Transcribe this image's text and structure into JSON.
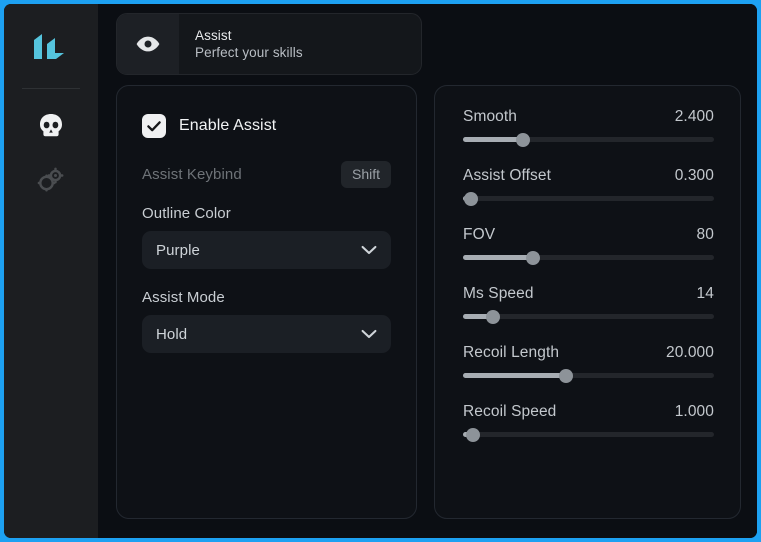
{
  "window": {
    "accent_border_color": "#1da1f2",
    "background_color": "#0b0e13",
    "sidebar_color": "#1c1e21"
  },
  "sidebar": {
    "logo": {
      "icon": "bars-logo-icon",
      "color": "#55c4dd"
    },
    "items": [
      {
        "icon": "skull-icon",
        "name": "sidebar-item-skull",
        "active": true
      },
      {
        "icon": "gears-icon",
        "name": "sidebar-item-settings",
        "active": false
      }
    ]
  },
  "header": {
    "icon": "eye-icon",
    "title": "Assist",
    "subtitle": "Perfect your skills"
  },
  "left_panel": {
    "enable": {
      "label": "Enable Assist",
      "checked": true,
      "icon": "check-icon"
    },
    "keybind": {
      "label": "Assist Keybind",
      "value": "Shift"
    },
    "fields": [
      {
        "label": "Outline Color",
        "value": "Purple",
        "icon": "chevron-down-icon"
      },
      {
        "label": "Assist Mode",
        "value": "Hold",
        "icon": "chevron-down-icon"
      }
    ]
  },
  "right_panel": {
    "sliders": [
      {
        "label": "Smooth",
        "value": "2.400",
        "percent": 24
      },
      {
        "label": "Assist Offset",
        "value": "0.300",
        "percent": 3
      },
      {
        "label": "FOV",
        "value": "80",
        "percent": 28
      },
      {
        "label": "Ms Speed",
        "value": "14",
        "percent": 12
      },
      {
        "label": "Recoil Length",
        "value": "20.000",
        "percent": 41
      },
      {
        "label": "Recoil Speed",
        "value": "1.000",
        "percent": 4
      }
    ]
  }
}
